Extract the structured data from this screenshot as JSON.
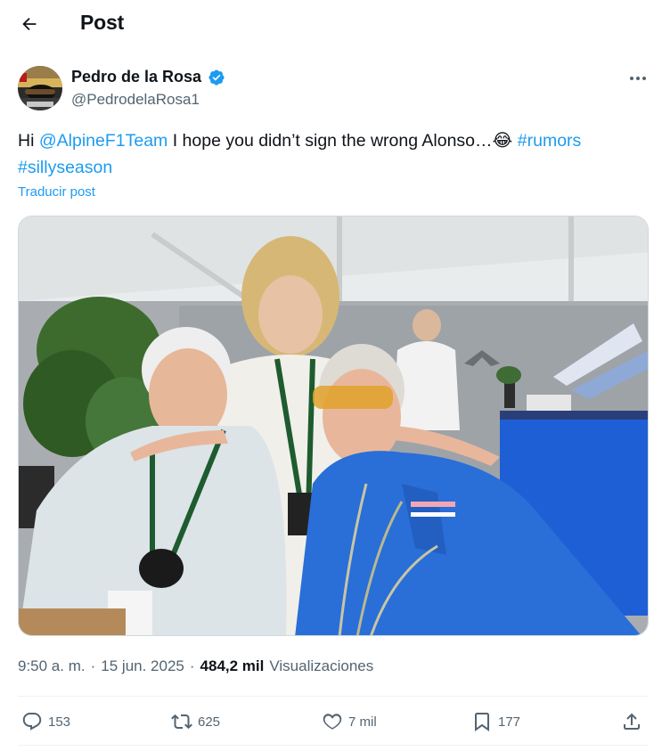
{
  "header": {
    "title": "Post",
    "back_icon": "arrow-left-icon"
  },
  "author": {
    "name": "Pedro de la Rosa",
    "handle": "@PedrodelaRosa1",
    "verified": true,
    "verified_color": "#1d9bf0"
  },
  "post": {
    "text_parts": {
      "p1": "Hi ",
      "mention": "@AlpineF1Team",
      "p2": " I hope you didn’t sign the wrong Alonso…",
      "emoji": "😂",
      "hashtag1": "#rumors",
      "hashtag2": "#sillyseason"
    },
    "translate_label": "Traducir post",
    "link_color": "#1d9bf0"
  },
  "meta": {
    "time": "9:50 a. m.",
    "sep1": "·",
    "date": "15 jun. 2025",
    "sep2": "·",
    "views_count": "484,2 mil",
    "views_label": "Visualizaciones"
  },
  "actions": {
    "replies": "153",
    "reposts": "625",
    "likes": "7 mil",
    "bookmarks": "177"
  },
  "media": {
    "description_icons": [
      "alpine-logo-icon"
    ]
  }
}
